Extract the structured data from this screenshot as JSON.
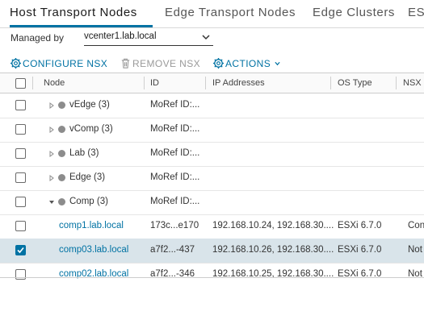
{
  "tabs": [
    {
      "label": "Host Transport Nodes",
      "active": true
    },
    {
      "label": "Edge Transport Nodes"
    },
    {
      "label": "Edge Clusters"
    },
    {
      "label": "ES"
    }
  ],
  "managed_by": {
    "label": "Managed by",
    "value": "vcenter1.lab.local"
  },
  "toolbar": {
    "configure_label": "CONFIGURE NSX",
    "remove_label": "REMOVE NSX",
    "actions_label": "ACTIONS"
  },
  "columns": [
    "Node",
    "ID",
    "IP Addresses",
    "OS Type",
    "NSX"
  ],
  "rows": [
    {
      "node": "vEdge (3)",
      "id": "MoRef ID:...",
      "ip": "",
      "os": "",
      "nsx": "",
      "type": "group",
      "expanded": false
    },
    {
      "node": "vComp (3)",
      "id": "MoRef ID:...",
      "ip": "",
      "os": "",
      "nsx": "",
      "type": "group",
      "expanded": false
    },
    {
      "node": "Lab (3)",
      "id": "MoRef ID:...",
      "ip": "",
      "os": "",
      "nsx": "",
      "type": "group",
      "expanded": false
    },
    {
      "node": "Edge (3)",
      "id": "MoRef ID:...",
      "ip": "",
      "os": "",
      "nsx": "",
      "type": "group",
      "expanded": false
    },
    {
      "node": "Comp (3)",
      "id": "MoRef ID:...",
      "ip": "",
      "os": "",
      "nsx": "",
      "type": "group",
      "expanded": true
    },
    {
      "node": "comp1.lab.local",
      "id": "173c...e170",
      "ip": "192.168.10.24, 192.168.30....",
      "os": "ESXi 6.7.0",
      "nsx": "Con",
      "type": "host",
      "checked": false
    },
    {
      "node": "comp03.lab.local",
      "id": "a7f2...-437",
      "ip": "192.168.10.26, 192.168.30....",
      "os": "ESXi 6.7.0",
      "nsx": "Not",
      "type": "host",
      "checked": true
    },
    {
      "node": "comp02.lab.local",
      "id": "a7f2...-346",
      "ip": "192.168.10.25, 192.168.30....",
      "os": "ESXi 6.7.0",
      "nsx": "Not",
      "type": "host",
      "checked": false
    }
  ],
  "colors": {
    "accent": "#0072a3",
    "selected_row": "#d9e4ea",
    "status_dot": "#8c8c8c"
  }
}
